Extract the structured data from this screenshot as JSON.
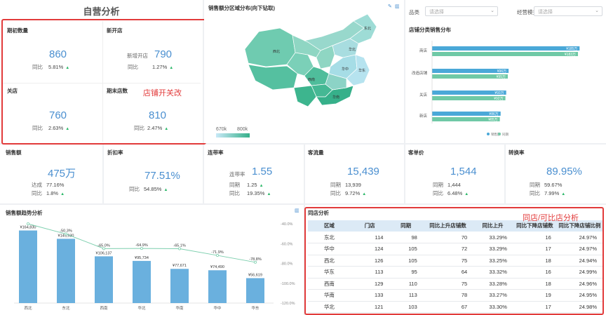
{
  "app_title": "自营分析",
  "store_kpis": {
    "opening": {
      "title": "期初数量",
      "value": "860",
      "yoy_label": "同比",
      "yoy": "5.81%"
    },
    "new": {
      "title": "新开店",
      "sub_label": "新增开店",
      "value": "790",
      "yoy_label": "同比",
      "yoy": "1.27%"
    },
    "closed": {
      "title": "关店",
      "value": "760",
      "yoy_label": "同比",
      "yoy": "2.63%"
    },
    "ending": {
      "title": "期末店数",
      "value": "810",
      "yoy_label": "同比",
      "yoy": "2.47%"
    }
  },
  "annotations": {
    "store_open_close": "店铺开关改",
    "same_store": "同店/可比店分析"
  },
  "map": {
    "title": "销售额分区域分布(向下钻取)",
    "legend_min": "670k",
    "legend_max": "800k",
    "labels": [
      "华北",
      "东北",
      "西北",
      "华东",
      "华中",
      "西南",
      "华南"
    ]
  },
  "filters": {
    "category": {
      "label": "品类",
      "placeholder": "请选择"
    },
    "mode": {
      "label": "经营模式",
      "placeholder": "请选择"
    }
  },
  "store_type_chart": {
    "title": "店铺分类销售分布",
    "legend": [
      "销售额",
      "同期"
    ],
    "colors": [
      "#4aa8d8",
      "#6fc9a6"
    ]
  },
  "kpis2": {
    "sales": {
      "title": "销售额",
      "value": "475万",
      "l1": "达成",
      "v1": "77.16%",
      "l2": "同比",
      "v2": "1.8%"
    },
    "discount": {
      "title": "折扣率",
      "value": "77.51%",
      "l1": "同比",
      "v1": "54.85%"
    },
    "attach": {
      "title": "连带率",
      "sub": "连带率",
      "value": "1.55",
      "l1": "同期",
      "v1": "1.25",
      "l2": "同比",
      "v2": "19.35%"
    },
    "traffic": {
      "title": "客流量",
      "value": "15,439",
      "l1": "同期",
      "v1": "13,939",
      "l2": "同比",
      "v2": "9.72%"
    },
    "unitprice": {
      "title": "客单价",
      "value": "1,544",
      "l1": "同期",
      "v1": "1,444",
      "l2": "同比",
      "v2": "6.48%"
    },
    "conversion": {
      "title": "转换率",
      "value": "89.95%",
      "l1": "同期",
      "v1": "59.67%",
      "l2": "同比",
      "v2": "7.99%"
    }
  },
  "trend": {
    "title": "销售额趋势分析"
  },
  "same_store": {
    "title": "同店分析",
    "columns": [
      "区域",
      "门店",
      "同期",
      "同比上升店铺数",
      "同比上升",
      "同比下降店铺数",
      "同比下降店铺比例"
    ],
    "rows": [
      [
        "东北",
        "114",
        "98",
        "70",
        "33.29%",
        "16",
        "24.97%"
      ],
      [
        "华中",
        "124",
        "105",
        "72",
        "33.29%",
        "17",
        "24.97%"
      ],
      [
        "西北",
        "126",
        "105",
        "75",
        "33.25%",
        "18",
        "24.94%"
      ],
      [
        "华东",
        "113",
        "95",
        "64",
        "33.32%",
        "16",
        "24.99%"
      ],
      [
        "西南",
        "129",
        "110",
        "75",
        "33.28%",
        "18",
        "24.96%"
      ],
      [
        "华南",
        "133",
        "113",
        "78",
        "33.27%",
        "19",
        "24.95%"
      ],
      [
        "华北",
        "121",
        "103",
        "67",
        "33.30%",
        "17",
        "24.98%"
      ]
    ]
  },
  "chart_data": [
    {
      "type": "bar",
      "title": "店铺分类销售分布",
      "orientation": "horizontal",
      "categories": [
        "商店",
        "改造店铺",
        "关店",
        "新店"
      ],
      "series": [
        {
          "name": "销售额",
          "values": [
            185,
            96,
            93,
            86
          ],
          "labels": [
            "¥185万",
            "¥96万",
            "¥93万",
            "¥86万"
          ]
        },
        {
          "name": "同期",
          "values": [
            183,
            95,
            92,
            85
          ],
          "labels": [
            "¥183万",
            "¥95万",
            "¥92万",
            "¥85万"
          ]
        }
      ]
    },
    {
      "type": "bar",
      "title": "销售额趋势分析",
      "categories": [
        "西北",
        "东北",
        "西南",
        "华北",
        "华南",
        "华中",
        "华东"
      ],
      "series": [
        {
          "name": "销售额",
          "values": [
            164830,
            145930,
            106137,
            95734,
            77671,
            74490,
            56619
          ],
          "labels": [
            "¥164,830",
            "¥145,930",
            "¥106,137",
            "¥95,734",
            "¥77,671",
            "¥74,490",
            "¥56,619"
          ]
        },
        {
          "name": "同比",
          "type": "line",
          "values": [
            -40.0,
            -50.3,
            -65.0,
            -64.9,
            -65.1,
            -71.9,
            -78.8
          ],
          "labels": [
            "",
            "-50.3%",
            "-65.0%",
            "-64.9%",
            "-65.1%",
            "-71.9%",
            "-78.8%"
          ]
        }
      ],
      "y2_ticks": [
        "-40.0%",
        "-60.0%",
        "-80.0%",
        "-100.0%",
        "-120.0%"
      ],
      "y2lim": [
        -120,
        -40
      ]
    }
  ]
}
